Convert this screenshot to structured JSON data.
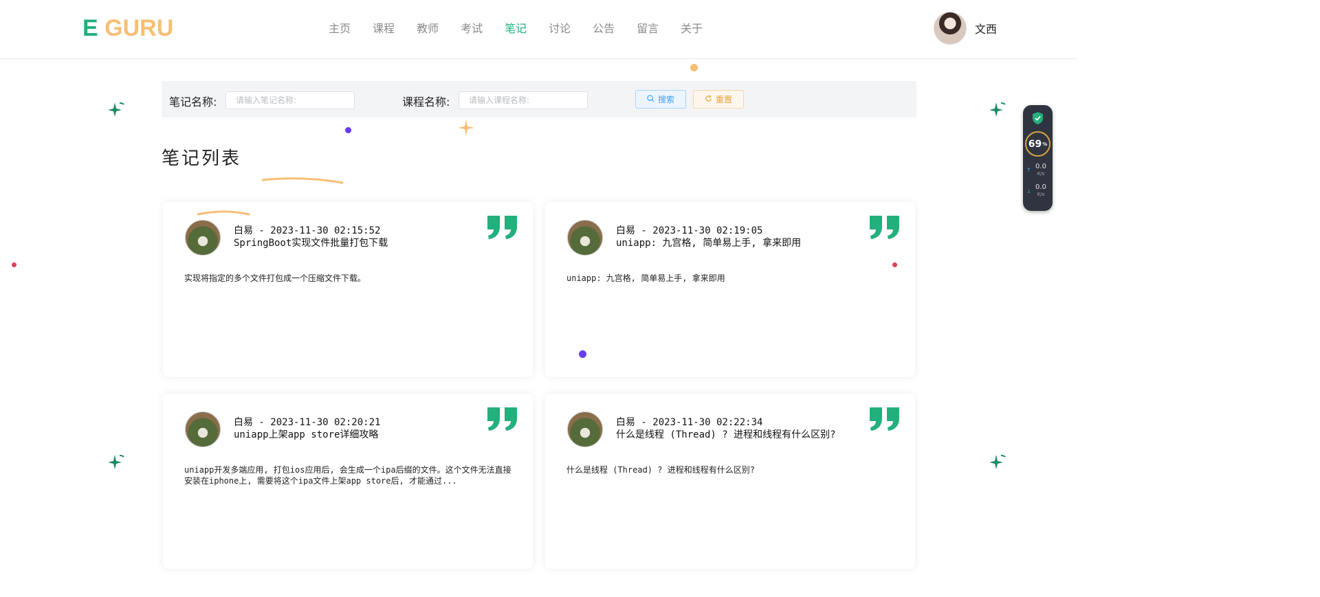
{
  "header": {
    "logo_e": "E",
    "logo_rest": "GURU",
    "nav": [
      "主页",
      "课程",
      "教师",
      "考试",
      "笔记",
      "讨论",
      "公告",
      "留言",
      "关于"
    ],
    "active_nav": "笔记",
    "user_name": "文西"
  },
  "search": {
    "note_label": "笔记名称:",
    "note_placeholder": "请输入笔记名称:",
    "course_label": "课程名称:",
    "course_placeholder": "请输入课程名称:",
    "search_button": "搜索",
    "reset_button": "重置"
  },
  "section_title": "笔记列表",
  "notes": [
    {
      "author_time": "白易 - 2023-11-30 02:15:52",
      "title": "SpringBoot实现文件批量打包下载",
      "desc": "实现将指定的多个文件打包成一个压缩文件下载。"
    },
    {
      "author_time": "白易 - 2023-11-30 02:19:05",
      "title": "uniapp: 九宫格, 简单易上手, 拿来即用",
      "desc": "uniapp: 九宫格, 简单易上手, 拿来即用"
    },
    {
      "author_time": "白易 - 2023-11-30 02:20:21",
      "title": "uniapp上架app store详细攻略",
      "desc": "uniapp开发多端应用, 打包ios应用后, 会生成一个ipa后缀的文件。这个文件无法直接安装在iphone上, 需要将这个ipa文件上架app store后, 才能通过..."
    },
    {
      "author_time": "白易 - 2023-11-30 02:22:34",
      "title": "什么是线程 (Thread) ? 进程和线程有什么区别?",
      "desc": "什么是线程 (Thread) ? 进程和线程有什么区别?"
    }
  ],
  "widget": {
    "percent": "69",
    "percent_unit": "%",
    "up_speed": "0.0",
    "down_speed": "0.0",
    "speed_unit": "K/s"
  },
  "colors": {
    "brand_green": "#22b07d",
    "brand_orange": "#f7be74",
    "search_blue": "#409eff",
    "reset_orange": "#e6a23c"
  }
}
